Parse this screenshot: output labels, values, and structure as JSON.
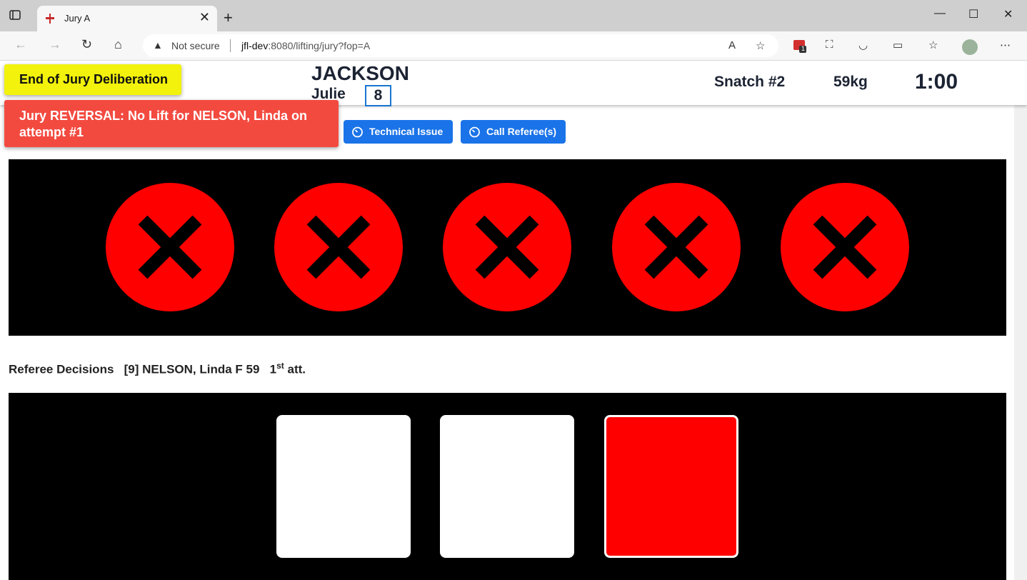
{
  "browser": {
    "tab_title": "Jury A",
    "address": {
      "security": "Not secure",
      "host": "jfl-dev",
      "path": ":8080/lifting/jury?fop=A"
    },
    "extension_badge": "1"
  },
  "header": {
    "last_name": "JACKSON",
    "first_name": "Julie",
    "start_number": "8",
    "attempt": "Snatch #2",
    "weight": "59kg",
    "clock": "1:00"
  },
  "notifications": {
    "deliberation": "End of Jury Deliberation",
    "reversal": "Jury REVERSAL: No Lift for NELSON, Linda on attempt #1"
  },
  "actions": {
    "technical_issue": "Technical Issue",
    "call_referees": "Call Referee(s)"
  },
  "jury_decisions": [
    "no-lift",
    "no-lift",
    "no-lift",
    "no-lift",
    "no-lift"
  ],
  "referee_section": {
    "title": "Referee Decisions",
    "athlete": "[9] NELSON, Linda F 59",
    "attempt_num": "1",
    "attempt_suffix": "st",
    "attempt_word": "att.",
    "decisions": [
      "good",
      "good",
      "bad"
    ]
  },
  "colors": {
    "no_lift": "#ff0000",
    "good_lift": "#ffffff",
    "button_blue": "#1a73e8",
    "notification_red": "#f34a40",
    "notification_yellow": "#f2f20c"
  }
}
